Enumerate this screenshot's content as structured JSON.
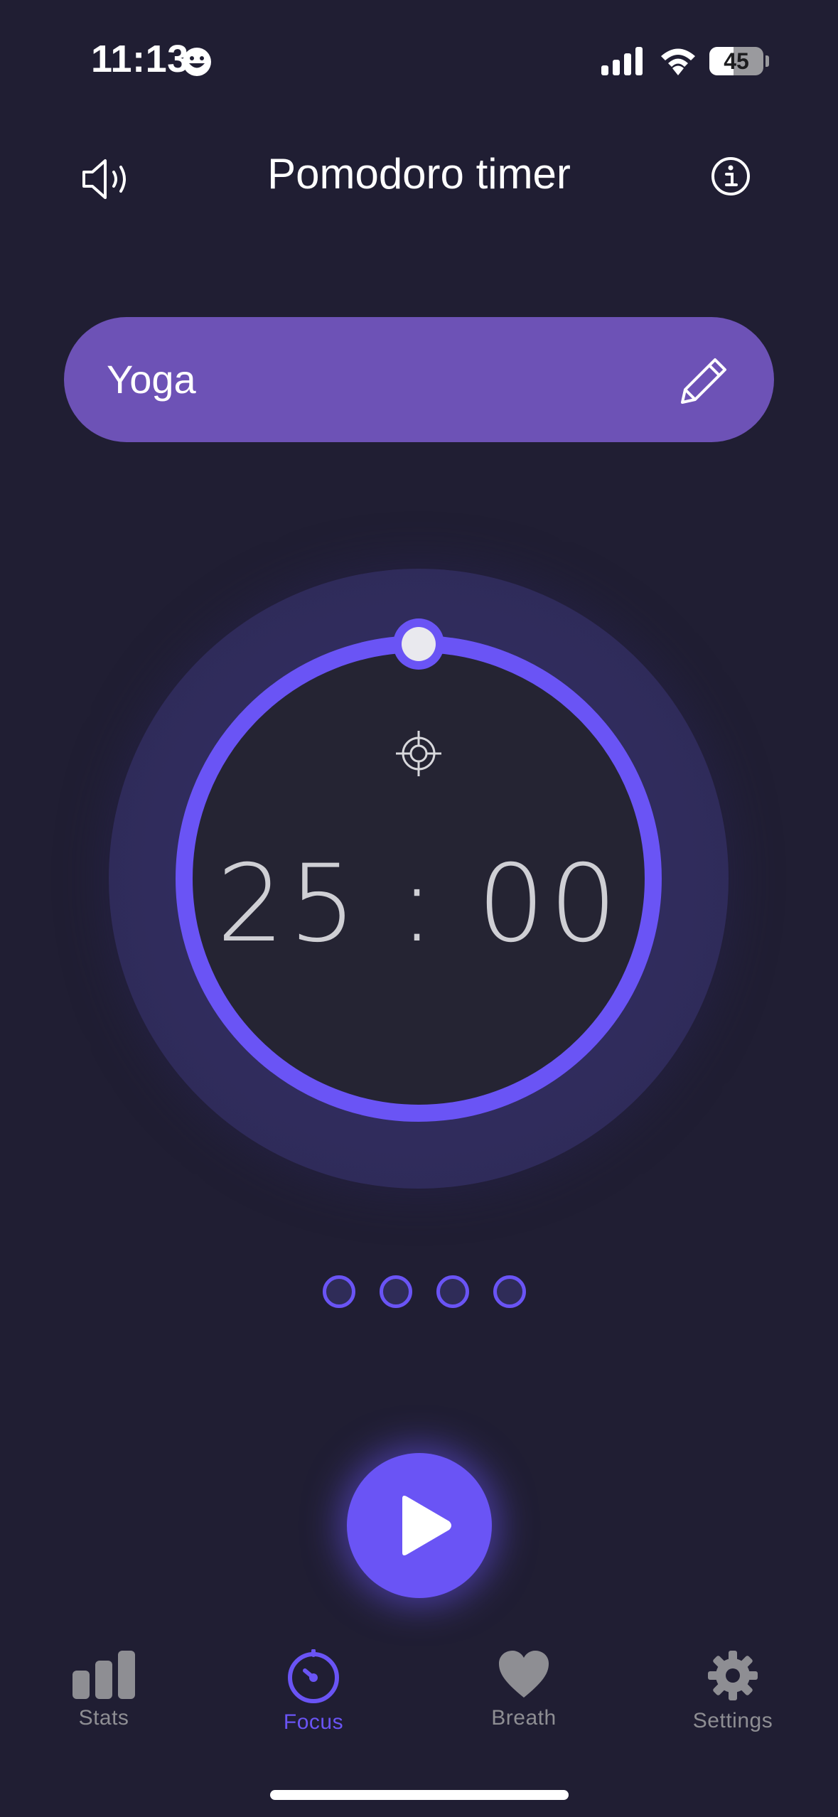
{
  "status_bar": {
    "time": "11:13",
    "battery_level": "45",
    "battery_fraction": 0.45,
    "icons": [
      "smiley-face-icon",
      "cellular-signal-icon",
      "wifi-icon",
      "battery-icon"
    ]
  },
  "header": {
    "title": "Pomodoro timer",
    "left_icon": "speaker-icon",
    "right_icon": "info-icon"
  },
  "task": {
    "name": "Yoga",
    "edit_icon": "pencil-icon"
  },
  "timer": {
    "time": "25 : 00",
    "focus_icon": "crosshair-icon",
    "progress_fraction": 1.0
  },
  "sessions": {
    "total": 4,
    "completed": 0
  },
  "controls": {
    "play_icon": "play-icon"
  },
  "tab_bar": {
    "tabs": [
      {
        "label": "Stats",
        "icon": "bar-chart-icon",
        "active": false
      },
      {
        "label": "Focus",
        "icon": "timer-icon",
        "active": true
      },
      {
        "label": "Breath",
        "icon": "heart-icon",
        "active": false
      },
      {
        "label": "Settings",
        "icon": "gear-icon",
        "active": false
      }
    ]
  },
  "colors": {
    "background": "#201e33",
    "accent": "#6a54f5",
    "task_pill": "#6d52b6",
    "inactive_tab": "#8e8e93"
  }
}
